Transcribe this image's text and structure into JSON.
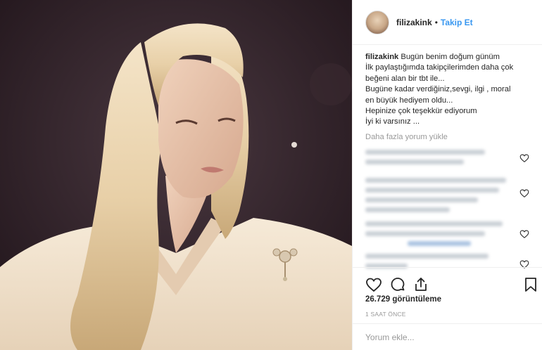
{
  "post": {
    "photo_alt": "",
    "header": {
      "username": "filizakink",
      "separator": "•",
      "follow_label": "Takip Et"
    },
    "caption": {
      "username": "filizakink",
      "lines": [
        "Bugün benim doğum günüm",
        "İlk paylaştığımda takipçilerimden daha çok",
        "beğeni alan bir tbt ile...",
        "Bugüne kadar verdiğiniz,sevgi, ilgi , moral",
        "en büyük hediyem oldu...",
        "Hepinize çok teşekkür ediyorum",
        "İyi ki varsınız ..."
      ]
    },
    "load_more_label": "Daha fazla yorum yükle",
    "actions": {
      "like_icon": "heart-icon",
      "comment_icon": "comment-icon",
      "share_icon": "share-icon",
      "save_icon": "bookmark-icon"
    },
    "views_label": "26.729 görüntüleme",
    "time_label": "1 SAAT ÖNCE",
    "comment_placeholder": "Yorum ekle..."
  },
  "colors": {
    "link_blue": "#3897f0",
    "text": "#262626",
    "muted": "#999999",
    "divider": "#efefef"
  }
}
